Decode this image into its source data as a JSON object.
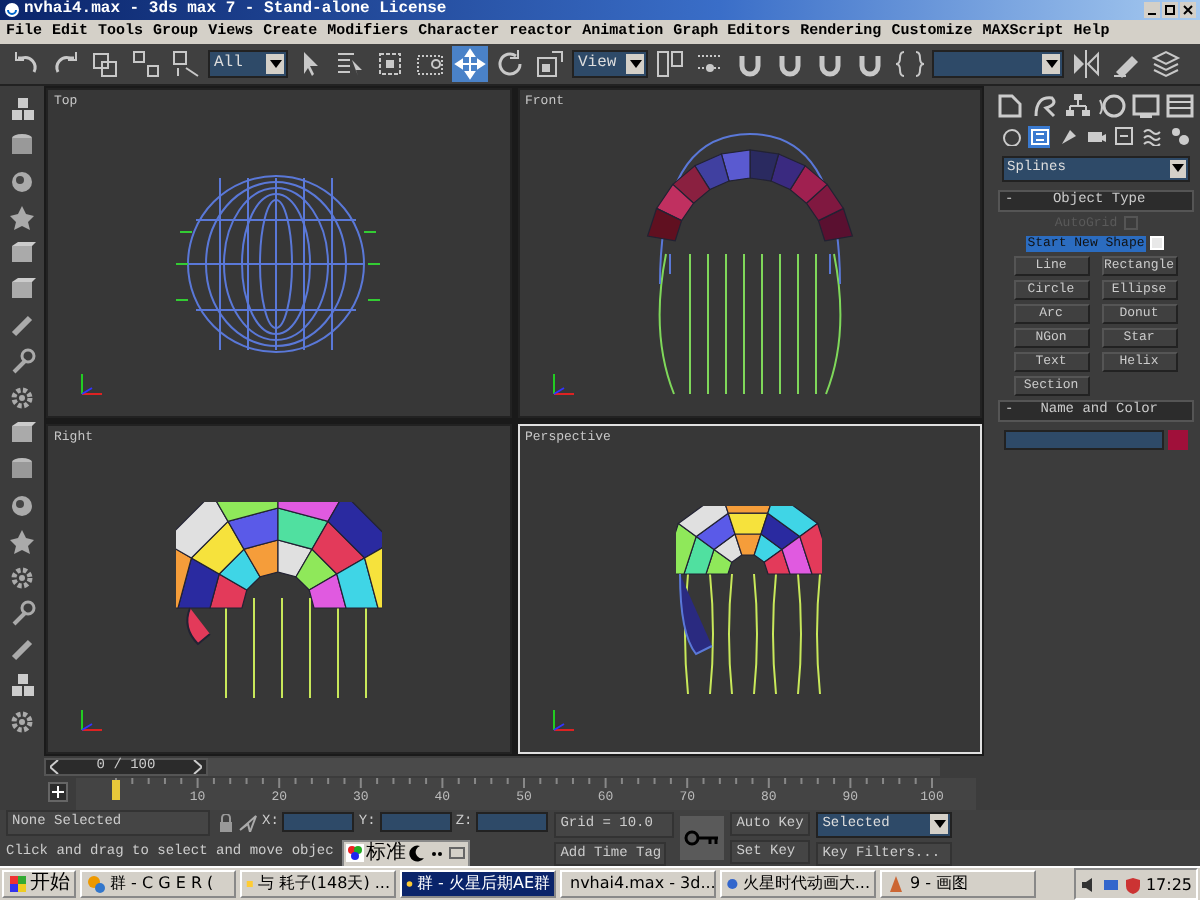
{
  "window": {
    "title": "nvhai4.max - 3ds max 7  - Stand-alone License"
  },
  "menu": [
    "File",
    "Edit",
    "Tools",
    "Group",
    "Views",
    "Create",
    "Modifiers",
    "Character",
    "reactor",
    "Animation",
    "Graph Editors",
    "Rendering",
    "Customize",
    "MAXScript",
    "Help"
  ],
  "toolbar": {
    "selection_filter": "All",
    "reference_coordinate": "View"
  },
  "viewports": [
    {
      "label": "Top",
      "kind": "top",
      "selected": false
    },
    {
      "label": "Front",
      "kind": "front",
      "selected": false
    },
    {
      "label": "Right",
      "kind": "right",
      "selected": false
    },
    {
      "label": "Perspective",
      "kind": "perspective",
      "selected": true
    }
  ],
  "time_slider": {
    "position": "0 / 100",
    "level": 0
  },
  "track_ticks": [
    "10",
    "20",
    "30",
    "40",
    "50",
    "60",
    "70",
    "80",
    "90",
    "100"
  ],
  "command_panel": {
    "category": "Splines",
    "object_type": {
      "title": "Object Type",
      "sign": "-",
      "autogrid": {
        "label": "AutoGrid",
        "checked": false,
        "disabled": true
      },
      "start_new_shape": {
        "label": "Start New Shape",
        "checked": true
      },
      "buttons": [
        "Line",
        "Rectangle",
        "Circle",
        "Ellipse",
        "Arc",
        "Donut",
        "NGon",
        "Star",
        "Text",
        "Helix",
        "Section"
      ]
    },
    "name_and_color": {
      "title": "Name and Color",
      "sign": "-",
      "color": "#a0103a"
    }
  },
  "status": {
    "selection": "None Selected",
    "prompt": "Click and drag to select and move objec",
    "x_label": "X:",
    "y_label": "Y:",
    "z_label": "Z:",
    "grid": "Grid = 10.0",
    "add_time_tag": "Add Time Tag",
    "auto_key": "Auto Key",
    "key_mode": "Selected",
    "set_key": "Set Key",
    "key_filters": "Key Filters..."
  },
  "ime": {
    "label": "标准"
  },
  "taskbar": {
    "start": "开始",
    "tasks": [
      {
        "label": "群 - C G E R (",
        "selected": false
      },
      {
        "label": "与 耗子(148天) ...",
        "selected": false
      },
      {
        "label": "群 - 火星后期AE群",
        "selected": true
      },
      {
        "label": "nvhai4.max - 3d...",
        "selected": false
      },
      {
        "label": "火星时代动画大...",
        "selected": false
      },
      {
        "label": "9 - 画图",
        "selected": false
      }
    ],
    "clock": "17:25"
  }
}
